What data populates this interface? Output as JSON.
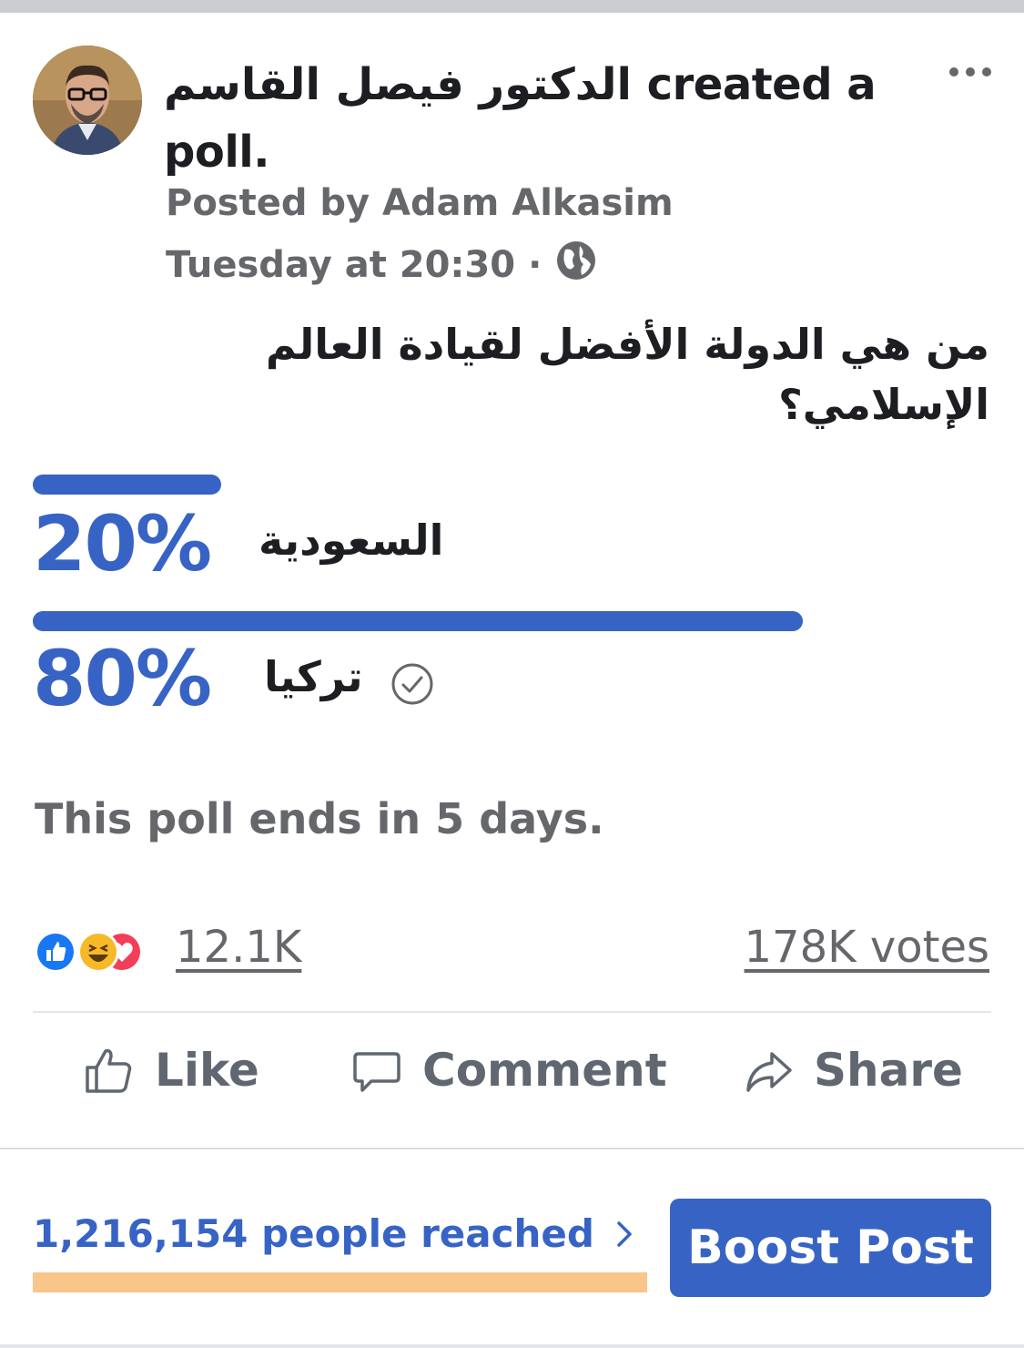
{
  "post": {
    "author_name": "الدكتور فيصل القاسم",
    "action_text": "created a poll.",
    "posted_by": "Posted by Adam Alkasim",
    "timestamp": "Tuesday at 20:30",
    "separator": "·",
    "audience_icon": "globe-icon",
    "more_icon": "more-options-icon"
  },
  "poll": {
    "question": "من هي الدولة الأفضل لقيادة العالم الإسلامي؟",
    "options": [
      {
        "label": "السعودية",
        "percent_text": "20%",
        "percent": 20,
        "voted": false
      },
      {
        "label": "تركيا",
        "percent_text": "80%",
        "percent": 80,
        "voted": true
      }
    ],
    "ends_text": "This poll ends in 5 days."
  },
  "engagement": {
    "reaction_icons": [
      "like-icon",
      "haha-icon",
      "love-icon"
    ],
    "reaction_count": "12.1K",
    "votes": "178K votes"
  },
  "actions": {
    "like": "Like",
    "comment": "Comment",
    "share": "Share"
  },
  "insights": {
    "reach": "1,216,154 people reached",
    "boost": "Boost Post"
  },
  "colors": {
    "accent": "#3763c5",
    "muted": "#65676b",
    "highlight": "#f9c58b"
  }
}
